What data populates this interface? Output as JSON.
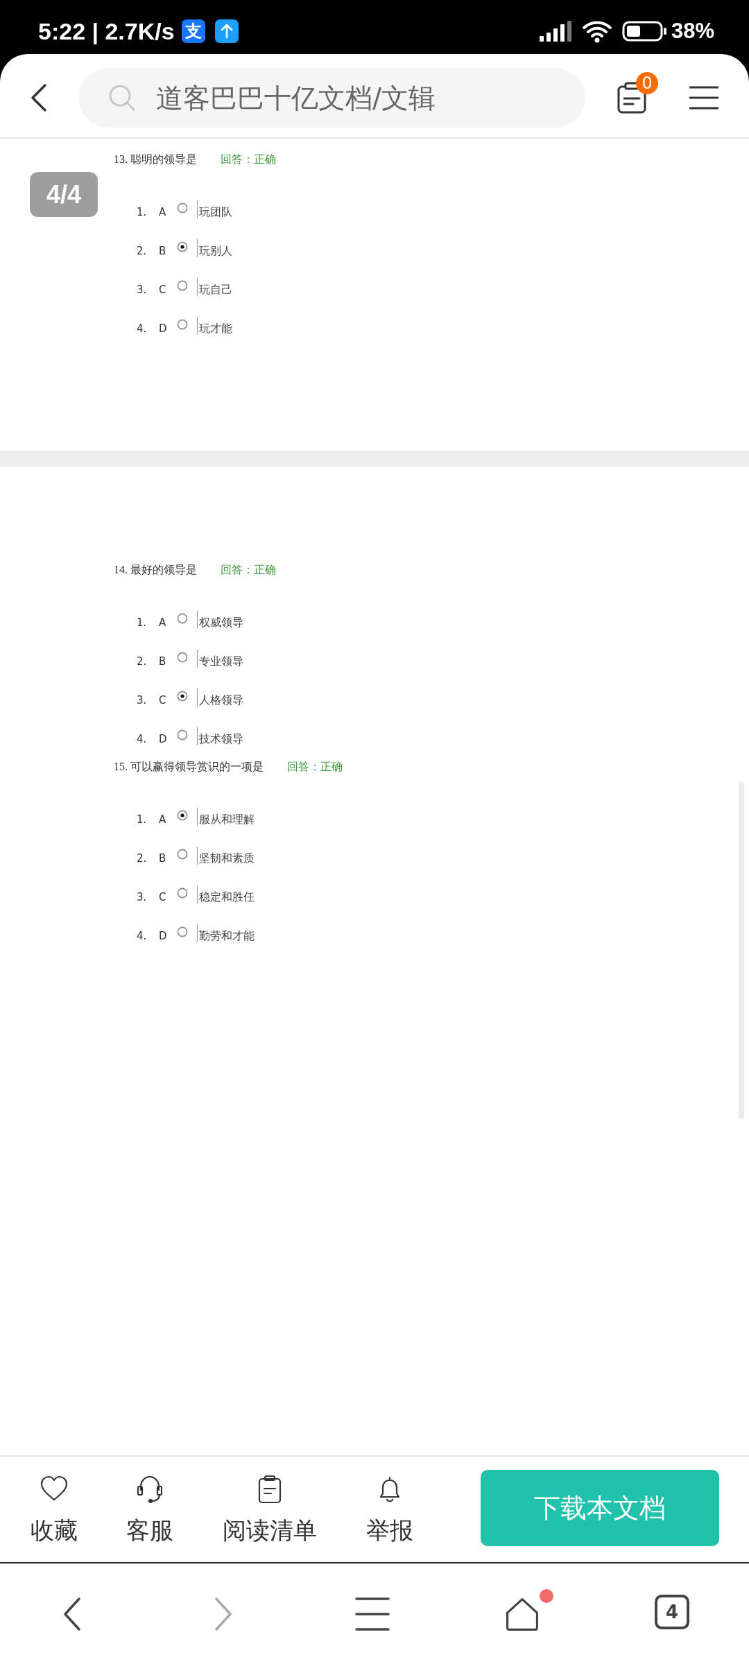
{
  "status_bar": {
    "time_speed": "5:22 | 2.7K/s",
    "app_icon": "支",
    "battery": "38%"
  },
  "header": {
    "search": {
      "placeholder": "道客巴巴十亿文档/文辑"
    },
    "list_badge": "0"
  },
  "page_indicator": "4/4",
  "pages": [
    {
      "questions": [
        {
          "title": "13. 聪明的领导是",
          "answer": "回答：正确",
          "options": [
            {
              "number": "1.",
              "letter": "A",
              "text": "玩团队",
              "selected": false
            },
            {
              "number": "2.",
              "letter": "B",
              "text": "玩别人",
              "selected": true
            },
            {
              "number": "3.",
              "letter": "C",
              "text": "玩自己",
              "selected": false
            },
            {
              "number": "4.",
              "letter": "D",
              "text": "玩才能",
              "selected": false
            }
          ]
        }
      ]
    },
    {
      "questions": [
        {
          "title": "14. 最好的领导是",
          "answer": "回答：正确",
          "options": [
            {
              "number": "1.",
              "letter": "A",
              "text": "权威领导",
              "selected": false
            },
            {
              "number": "2.",
              "letter": "B",
              "text": "专业领导",
              "selected": false
            },
            {
              "number": "3.",
              "letter": "C",
              "text": "人格领导",
              "selected": true
            },
            {
              "number": "4.",
              "letter": "D",
              "text": "技术领导",
              "selected": false
            }
          ]
        },
        {
          "title": "15. 可以赢得领导赏识的一项是",
          "answer": "回答：正确",
          "options": [
            {
              "number": "1.",
              "letter": "A",
              "text": "服从和理解",
              "selected": true
            },
            {
              "number": "2.",
              "letter": "B",
              "text": "坚韧和素质",
              "selected": false
            },
            {
              "number": "3.",
              "letter": "C",
              "text": "稳定和胜任",
              "selected": false
            },
            {
              "number": "4.",
              "letter": "D",
              "text": "勤劳和才能",
              "selected": false
            }
          ]
        }
      ]
    }
  ],
  "actions": [
    {
      "kind": "favorite",
      "label": "收藏"
    },
    {
      "kind": "service",
      "label": "客服"
    },
    {
      "kind": "reading_list",
      "label": "阅读清单"
    },
    {
      "kind": "report",
      "label": "举报"
    }
  ],
  "download_button": "下载本文档",
  "nav": [
    {
      "kind": "back",
      "disabled": false,
      "notification": false
    },
    {
      "kind": "forward",
      "disabled": true,
      "notification": false
    },
    {
      "kind": "menu",
      "disabled": false,
      "notification": false
    },
    {
      "kind": "home",
      "disabled": false,
      "notification": true
    },
    {
      "kind": "tabs",
      "count": "4",
      "disabled": false,
      "notification": false
    }
  ]
}
